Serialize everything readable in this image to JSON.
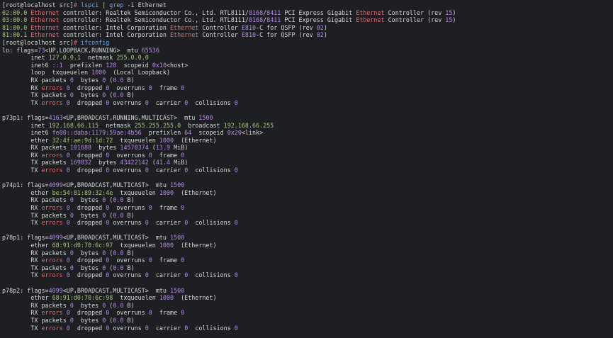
{
  "colors": {
    "background": "#1e1f22",
    "default": "#d7d7d7",
    "green": "#a9c77a",
    "red": "#e06c75",
    "purple": "#b689e6",
    "blue": "#73a7f0"
  },
  "lines": [
    [
      {
        "t": "[root@localhost src]",
        "c": "default"
      },
      {
        "t": "# ",
        "c": "red"
      },
      {
        "t": "lspci",
        "c": "blue"
      },
      {
        "t": " | ",
        "c": "default"
      },
      {
        "t": "grep",
        "c": "blue"
      },
      {
        "t": " -i Ethernet",
        "c": "default"
      }
    ],
    [
      {
        "t": "02:00.0 ",
        "c": "green"
      },
      {
        "t": "Ethernet",
        "c": "red"
      },
      {
        "t": " controller: Realtek Semiconductor Co., Ltd. RTL8111/",
        "c": "default"
      },
      {
        "t": "8168",
        "c": "purple"
      },
      {
        "t": "/",
        "c": "default"
      },
      {
        "t": "8411",
        "c": "purple"
      },
      {
        "t": " PCI Express Gigabit ",
        "c": "default"
      },
      {
        "t": "Ethernet",
        "c": "red"
      },
      {
        "t": " Controller (rev ",
        "c": "default"
      },
      {
        "t": "15",
        "c": "purple"
      },
      {
        "t": ")",
        "c": "default"
      }
    ],
    [
      {
        "t": "03:00.0 ",
        "c": "green"
      },
      {
        "t": "Ethernet",
        "c": "red"
      },
      {
        "t": " controller: Realtek Semiconductor Co., Ltd. RTL8111/",
        "c": "default"
      },
      {
        "t": "8168",
        "c": "purple"
      },
      {
        "t": "/",
        "c": "default"
      },
      {
        "t": "8411",
        "c": "purple"
      },
      {
        "t": " PCI Express Gigabit ",
        "c": "default"
      },
      {
        "t": "Ethernet",
        "c": "red"
      },
      {
        "t": " Controller (rev ",
        "c": "default"
      },
      {
        "t": "15",
        "c": "purple"
      },
      {
        "t": ")",
        "c": "default"
      }
    ],
    [
      {
        "t": "81:00.0 ",
        "c": "green"
      },
      {
        "t": "Ethernet",
        "c": "red"
      },
      {
        "t": " controller: Intel Corporation ",
        "c": "default"
      },
      {
        "t": "Ethernet",
        "c": "red"
      },
      {
        "t": " Controller ",
        "c": "default"
      },
      {
        "t": "E810",
        "c": "purple"
      },
      {
        "t": "-C for QSFP (rev ",
        "c": "default"
      },
      {
        "t": "02",
        "c": "purple"
      },
      {
        "t": ")",
        "c": "default"
      }
    ],
    [
      {
        "t": "81:00.1 ",
        "c": "green"
      },
      {
        "t": "Ethernet",
        "c": "red"
      },
      {
        "t": " controller: Intel Corporation ",
        "c": "default"
      },
      {
        "t": "Ethernet",
        "c": "red"
      },
      {
        "t": " Controller ",
        "c": "default"
      },
      {
        "t": "E810",
        "c": "purple"
      },
      {
        "t": "-C for QSFP (rev ",
        "c": "default"
      },
      {
        "t": "02",
        "c": "purple"
      },
      {
        "t": ")",
        "c": "default"
      }
    ],
    [
      {
        "t": "[root@localhost src]",
        "c": "default"
      },
      {
        "t": "# ",
        "c": "red"
      },
      {
        "t": "ifconfig",
        "c": "blue"
      }
    ],
    [
      {
        "t": "lo: flags=",
        "c": "default"
      },
      {
        "t": "73",
        "c": "purple"
      },
      {
        "t": "<UP,LOOPBACK,RUNNING>  mtu ",
        "c": "default"
      },
      {
        "t": "65536",
        "c": "purple"
      }
    ],
    [
      {
        "t": "        inet ",
        "c": "default"
      },
      {
        "t": "127.0.0.1",
        "c": "green"
      },
      {
        "t": "  netmask ",
        "c": "default"
      },
      {
        "t": "255.0.0.0",
        "c": "green"
      }
    ],
    [
      {
        "t": "        inet6 ",
        "c": "default"
      },
      {
        "t": "::1",
        "c": "purple"
      },
      {
        "t": "  prefixlen ",
        "c": "default"
      },
      {
        "t": "128",
        "c": "purple"
      },
      {
        "t": "  scopeid ",
        "c": "default"
      },
      {
        "t": "0x10",
        "c": "purple"
      },
      {
        "t": "<host>",
        "c": "default"
      }
    ],
    [
      {
        "t": "        loop  txqueuelen ",
        "c": "default"
      },
      {
        "t": "1000",
        "c": "purple"
      },
      {
        "t": "  (Local Loopback)",
        "c": "default"
      }
    ],
    [
      {
        "t": "        RX packets ",
        "c": "default"
      },
      {
        "t": "0",
        "c": "purple"
      },
      {
        "t": "  bytes ",
        "c": "default"
      },
      {
        "t": "0",
        "c": "purple"
      },
      {
        "t": " (",
        "c": "default"
      },
      {
        "t": "0.0",
        "c": "purple"
      },
      {
        "t": " B)",
        "c": "default"
      }
    ],
    [
      {
        "t": "        RX ",
        "c": "default"
      },
      {
        "t": "errors",
        "c": "red"
      },
      {
        "t": " ",
        "c": "default"
      },
      {
        "t": "0",
        "c": "purple"
      },
      {
        "t": "  dropped ",
        "c": "default"
      },
      {
        "t": "0",
        "c": "purple"
      },
      {
        "t": "  overruns ",
        "c": "default"
      },
      {
        "t": "0",
        "c": "purple"
      },
      {
        "t": "  frame ",
        "c": "default"
      },
      {
        "t": "0",
        "c": "purple"
      }
    ],
    [
      {
        "t": "        TX packets ",
        "c": "default"
      },
      {
        "t": "0",
        "c": "purple"
      },
      {
        "t": "  bytes ",
        "c": "default"
      },
      {
        "t": "0",
        "c": "purple"
      },
      {
        "t": " (",
        "c": "default"
      },
      {
        "t": "0.0",
        "c": "purple"
      },
      {
        "t": " B)",
        "c": "default"
      }
    ],
    [
      {
        "t": "        TX ",
        "c": "default"
      },
      {
        "t": "errors",
        "c": "red"
      },
      {
        "t": " ",
        "c": "default"
      },
      {
        "t": "0",
        "c": "purple"
      },
      {
        "t": "  dropped ",
        "c": "default"
      },
      {
        "t": "0",
        "c": "purple"
      },
      {
        "t": " overruns ",
        "c": "default"
      },
      {
        "t": "0",
        "c": "purple"
      },
      {
        "t": "  carrier ",
        "c": "default"
      },
      {
        "t": "0",
        "c": "purple"
      },
      {
        "t": "  collisions ",
        "c": "default"
      },
      {
        "t": "0",
        "c": "purple"
      }
    ],
    [],
    [
      {
        "t": "p73p1: flags=",
        "c": "default"
      },
      {
        "t": "4163",
        "c": "purple"
      },
      {
        "t": "<UP,BROADCAST,RUNNING,MULTICAST>  mtu ",
        "c": "default"
      },
      {
        "t": "1500",
        "c": "purple"
      }
    ],
    [
      {
        "t": "        inet ",
        "c": "default"
      },
      {
        "t": "192.168.66.115",
        "c": "green"
      },
      {
        "t": "  netmask ",
        "c": "default"
      },
      {
        "t": "255.255.255.0",
        "c": "green"
      },
      {
        "t": "  broadcast ",
        "c": "default"
      },
      {
        "t": "192.168.66.255",
        "c": "green"
      }
    ],
    [
      {
        "t": "        inet6 ",
        "c": "default"
      },
      {
        "t": "fe80::daba:1179:59ae:4b56",
        "c": "purple"
      },
      {
        "t": "  prefixlen ",
        "c": "default"
      },
      {
        "t": "64",
        "c": "purple"
      },
      {
        "t": "  scopeid ",
        "c": "default"
      },
      {
        "t": "0x20",
        "c": "purple"
      },
      {
        "t": "<link>",
        "c": "default"
      }
    ],
    [
      {
        "t": "        ether ",
        "c": "default"
      },
      {
        "t": "32:4f:ae:9d:1d:72",
        "c": "green"
      },
      {
        "t": "  txqueuelen ",
        "c": "default"
      },
      {
        "t": "1000",
        "c": "purple"
      },
      {
        "t": "  (Ethernet)",
        "c": "default"
      }
    ],
    [
      {
        "t": "        RX packets ",
        "c": "default"
      },
      {
        "t": "101688",
        "c": "purple"
      },
      {
        "t": "  bytes ",
        "c": "default"
      },
      {
        "t": "14578374",
        "c": "purple"
      },
      {
        "t": " (",
        "c": "default"
      },
      {
        "t": "13.9",
        "c": "purple"
      },
      {
        "t": " MiB)",
        "c": "default"
      }
    ],
    [
      {
        "t": "        RX ",
        "c": "default"
      },
      {
        "t": "errors",
        "c": "red"
      },
      {
        "t": " ",
        "c": "default"
      },
      {
        "t": "0",
        "c": "purple"
      },
      {
        "t": "  dropped ",
        "c": "default"
      },
      {
        "t": "0",
        "c": "purple"
      },
      {
        "t": "  overruns ",
        "c": "default"
      },
      {
        "t": "0",
        "c": "purple"
      },
      {
        "t": "  frame ",
        "c": "default"
      },
      {
        "t": "0",
        "c": "purple"
      }
    ],
    [
      {
        "t": "        TX packets ",
        "c": "default"
      },
      {
        "t": "169032",
        "c": "purple"
      },
      {
        "t": "  bytes ",
        "c": "default"
      },
      {
        "t": "43422142",
        "c": "purple"
      },
      {
        "t": " (",
        "c": "default"
      },
      {
        "t": "41.4",
        "c": "purple"
      },
      {
        "t": " MiB)",
        "c": "default"
      }
    ],
    [
      {
        "t": "        TX ",
        "c": "default"
      },
      {
        "t": "errors",
        "c": "red"
      },
      {
        "t": " ",
        "c": "default"
      },
      {
        "t": "0",
        "c": "purple"
      },
      {
        "t": "  dropped ",
        "c": "default"
      },
      {
        "t": "0",
        "c": "purple"
      },
      {
        "t": " overruns ",
        "c": "default"
      },
      {
        "t": "0",
        "c": "purple"
      },
      {
        "t": "  carrier ",
        "c": "default"
      },
      {
        "t": "0",
        "c": "purple"
      },
      {
        "t": "  collisions ",
        "c": "default"
      },
      {
        "t": "0",
        "c": "purple"
      }
    ],
    [],
    [
      {
        "t": "p74p1: flags=",
        "c": "default"
      },
      {
        "t": "4099",
        "c": "purple"
      },
      {
        "t": "<UP,BROADCAST,MULTICAST>  mtu ",
        "c": "default"
      },
      {
        "t": "1500",
        "c": "purple"
      }
    ],
    [
      {
        "t": "        ether ",
        "c": "default"
      },
      {
        "t": "be:54:81:89:32:4e",
        "c": "green"
      },
      {
        "t": "  txqueuelen ",
        "c": "default"
      },
      {
        "t": "1000",
        "c": "purple"
      },
      {
        "t": "  (Ethernet)",
        "c": "default"
      }
    ],
    [
      {
        "t": "        RX packets ",
        "c": "default"
      },
      {
        "t": "0",
        "c": "purple"
      },
      {
        "t": "  bytes ",
        "c": "default"
      },
      {
        "t": "0",
        "c": "purple"
      },
      {
        "t": " (",
        "c": "default"
      },
      {
        "t": "0.0",
        "c": "purple"
      },
      {
        "t": " B)",
        "c": "default"
      }
    ],
    [
      {
        "t": "        RX ",
        "c": "default"
      },
      {
        "t": "errors",
        "c": "red"
      },
      {
        "t": " ",
        "c": "default"
      },
      {
        "t": "0",
        "c": "purple"
      },
      {
        "t": "  dropped ",
        "c": "default"
      },
      {
        "t": "0",
        "c": "purple"
      },
      {
        "t": "  overruns ",
        "c": "default"
      },
      {
        "t": "0",
        "c": "purple"
      },
      {
        "t": "  frame ",
        "c": "default"
      },
      {
        "t": "0",
        "c": "purple"
      }
    ],
    [
      {
        "t": "        TX packets ",
        "c": "default"
      },
      {
        "t": "0",
        "c": "purple"
      },
      {
        "t": "  bytes ",
        "c": "default"
      },
      {
        "t": "0",
        "c": "purple"
      },
      {
        "t": " (",
        "c": "default"
      },
      {
        "t": "0.0",
        "c": "purple"
      },
      {
        "t": " B)",
        "c": "default"
      }
    ],
    [
      {
        "t": "        TX ",
        "c": "default"
      },
      {
        "t": "errors",
        "c": "red"
      },
      {
        "t": " ",
        "c": "default"
      },
      {
        "t": "0",
        "c": "purple"
      },
      {
        "t": "  dropped ",
        "c": "default"
      },
      {
        "t": "0",
        "c": "purple"
      },
      {
        "t": " overruns ",
        "c": "default"
      },
      {
        "t": "0",
        "c": "purple"
      },
      {
        "t": "  carrier ",
        "c": "default"
      },
      {
        "t": "0",
        "c": "purple"
      },
      {
        "t": "  collisions ",
        "c": "default"
      },
      {
        "t": "0",
        "c": "purple"
      }
    ],
    [],
    [
      {
        "t": "p78p1: flags=",
        "c": "default"
      },
      {
        "t": "4099",
        "c": "purple"
      },
      {
        "t": "<UP,BROADCAST,MULTICAST>  mtu ",
        "c": "default"
      },
      {
        "t": "1500",
        "c": "purple"
      }
    ],
    [
      {
        "t": "        ether ",
        "c": "default"
      },
      {
        "t": "68:91:d0:70:6c:97",
        "c": "green"
      },
      {
        "t": "  txqueuelen ",
        "c": "default"
      },
      {
        "t": "1000",
        "c": "purple"
      },
      {
        "t": "  (Ethernet)",
        "c": "default"
      }
    ],
    [
      {
        "t": "        RX packets ",
        "c": "default"
      },
      {
        "t": "0",
        "c": "purple"
      },
      {
        "t": "  bytes ",
        "c": "default"
      },
      {
        "t": "0",
        "c": "purple"
      },
      {
        "t": " (",
        "c": "default"
      },
      {
        "t": "0.0",
        "c": "purple"
      },
      {
        "t": " B)",
        "c": "default"
      }
    ],
    [
      {
        "t": "        RX ",
        "c": "default"
      },
      {
        "t": "errors",
        "c": "red"
      },
      {
        "t": " ",
        "c": "default"
      },
      {
        "t": "0",
        "c": "purple"
      },
      {
        "t": "  dropped ",
        "c": "default"
      },
      {
        "t": "0",
        "c": "purple"
      },
      {
        "t": "  overruns ",
        "c": "default"
      },
      {
        "t": "0",
        "c": "purple"
      },
      {
        "t": "  frame ",
        "c": "default"
      },
      {
        "t": "0",
        "c": "purple"
      }
    ],
    [
      {
        "t": "        TX packets ",
        "c": "default"
      },
      {
        "t": "0",
        "c": "purple"
      },
      {
        "t": "  bytes ",
        "c": "default"
      },
      {
        "t": "0",
        "c": "purple"
      },
      {
        "t": " (",
        "c": "default"
      },
      {
        "t": "0.0",
        "c": "purple"
      },
      {
        "t": " B)",
        "c": "default"
      }
    ],
    [
      {
        "t": "        TX ",
        "c": "default"
      },
      {
        "t": "errors",
        "c": "red"
      },
      {
        "t": " ",
        "c": "default"
      },
      {
        "t": "0",
        "c": "purple"
      },
      {
        "t": "  dropped ",
        "c": "default"
      },
      {
        "t": "0",
        "c": "purple"
      },
      {
        "t": " overruns ",
        "c": "default"
      },
      {
        "t": "0",
        "c": "purple"
      },
      {
        "t": "  carrier ",
        "c": "default"
      },
      {
        "t": "0",
        "c": "purple"
      },
      {
        "t": "  collisions ",
        "c": "default"
      },
      {
        "t": "0",
        "c": "purple"
      }
    ],
    [],
    [
      {
        "t": "p78p2: flags=",
        "c": "default"
      },
      {
        "t": "4099",
        "c": "purple"
      },
      {
        "t": "<UP,BROADCAST,MULTICAST>  mtu ",
        "c": "default"
      },
      {
        "t": "1500",
        "c": "purple"
      }
    ],
    [
      {
        "t": "        ether ",
        "c": "default"
      },
      {
        "t": "68:91:d0:70:6c:98",
        "c": "green"
      },
      {
        "t": "  txqueuelen ",
        "c": "default"
      },
      {
        "t": "1000",
        "c": "purple"
      },
      {
        "t": "  (Ethernet)",
        "c": "default"
      }
    ],
    [
      {
        "t": "        RX packets ",
        "c": "default"
      },
      {
        "t": "0",
        "c": "purple"
      },
      {
        "t": "  bytes ",
        "c": "default"
      },
      {
        "t": "0",
        "c": "purple"
      },
      {
        "t": " (",
        "c": "default"
      },
      {
        "t": "0.0",
        "c": "purple"
      },
      {
        "t": " B)",
        "c": "default"
      }
    ],
    [
      {
        "t": "        RX ",
        "c": "default"
      },
      {
        "t": "errors",
        "c": "red"
      },
      {
        "t": " ",
        "c": "default"
      },
      {
        "t": "0",
        "c": "purple"
      },
      {
        "t": "  dropped ",
        "c": "default"
      },
      {
        "t": "0",
        "c": "purple"
      },
      {
        "t": "  overruns ",
        "c": "default"
      },
      {
        "t": "0",
        "c": "purple"
      },
      {
        "t": "  frame ",
        "c": "default"
      },
      {
        "t": "0",
        "c": "purple"
      }
    ],
    [
      {
        "t": "        TX packets ",
        "c": "default"
      },
      {
        "t": "0",
        "c": "purple"
      },
      {
        "t": "  bytes ",
        "c": "default"
      },
      {
        "t": "0",
        "c": "purple"
      },
      {
        "t": " (",
        "c": "default"
      },
      {
        "t": "0.0",
        "c": "purple"
      },
      {
        "t": " B)",
        "c": "default"
      }
    ],
    [
      {
        "t": "        TX ",
        "c": "default"
      },
      {
        "t": "errors",
        "c": "red"
      },
      {
        "t": " ",
        "c": "default"
      },
      {
        "t": "0",
        "c": "purple"
      },
      {
        "t": "  dropped ",
        "c": "default"
      },
      {
        "t": "0",
        "c": "purple"
      },
      {
        "t": " overruns ",
        "c": "default"
      },
      {
        "t": "0",
        "c": "purple"
      },
      {
        "t": "  carrier ",
        "c": "default"
      },
      {
        "t": "0",
        "c": "purple"
      },
      {
        "t": "  collisions ",
        "c": "default"
      },
      {
        "t": "0",
        "c": "purple"
      }
    ]
  ]
}
